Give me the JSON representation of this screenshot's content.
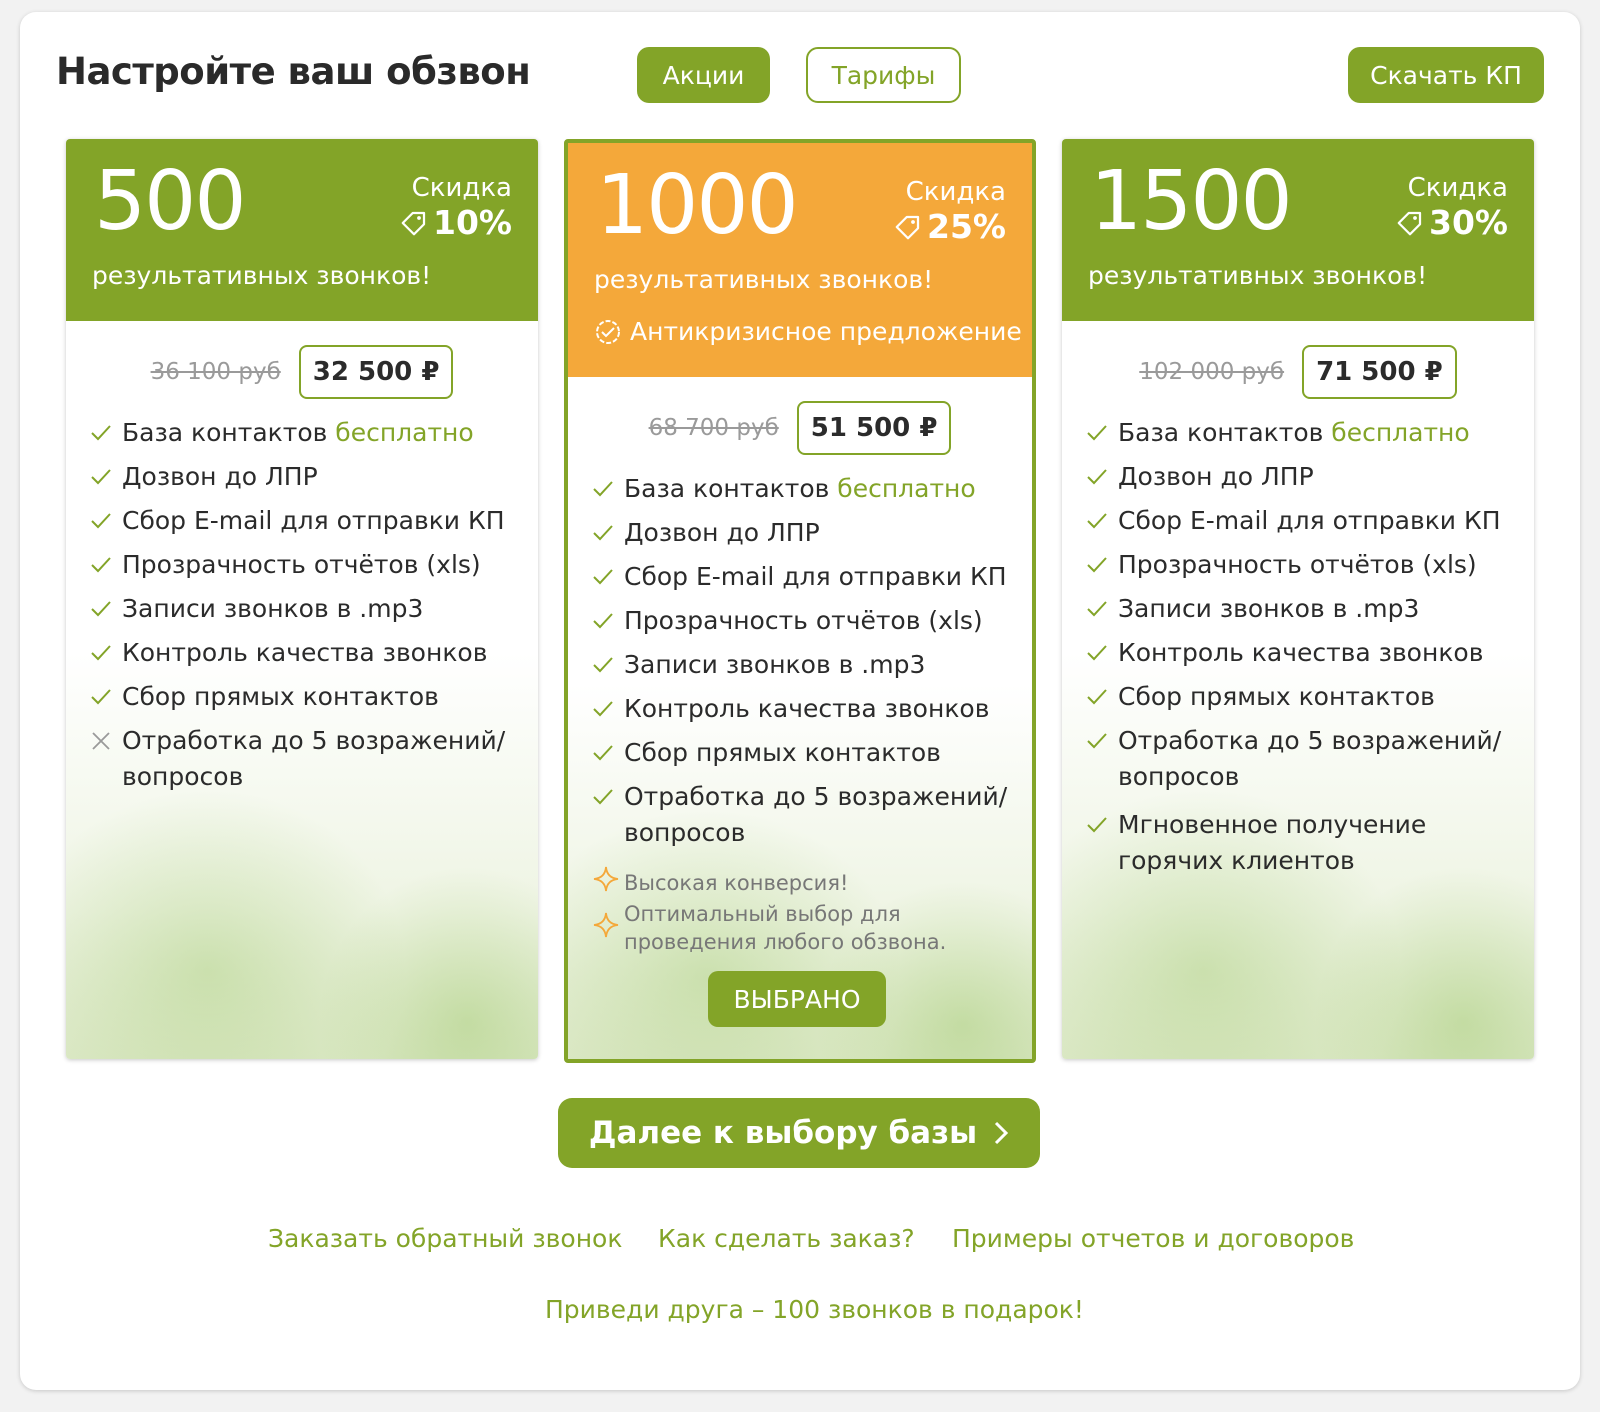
{
  "header": {
    "title": "Настройте ваш обзвон",
    "promo_label": "Акции",
    "tariffs_label": "Тарифы",
    "download_label": "Скачать КП"
  },
  "colors": {
    "accent": "#83a428",
    "highlight_card": "#f4a83a",
    "muted": "#9a9a9a"
  },
  "cards": [
    {
      "qty": "500",
      "discount_label": "Скидка",
      "discount_value": "10%",
      "subtitle": "результативных звонков!",
      "old_price": "36 100 руб",
      "new_price": "32 500 ₽",
      "features": {
        "f1": "База контактов ",
        "f1_hl": "бесплатно",
        "f2": "Дозвон до ЛПР",
        "f3": "Сбор E-mail для отправки КП",
        "f4": "Прозрачность отчётов (xls)",
        "f5": "Записи звонков в .mp3",
        "f6": "Контроль качества звонков",
        "f7": "Сбор прямых контактов",
        "f8": "Отработка до 5 возражений/ вопросов"
      }
    },
    {
      "qty": "1000",
      "discount_label": "Скидка",
      "discount_value": "25%",
      "subtitle": "результативных звонков!",
      "badge": "Антикризисное предложение",
      "old_price": "68 700 руб",
      "new_price": "51 500 ₽",
      "features": {
        "f1": "База контактов ",
        "f1_hl": "бесплатно",
        "f2": "Дозвон до ЛПР",
        "f3": "Сбор E-mail для отправки КП",
        "f4": "Прозрачность отчётов (xls)",
        "f5": "Записи звонков в .mp3",
        "f6": "Контроль качества звонков",
        "f7": "Сбор прямых контактов",
        "f8": "Отработка до 5 возражений/ вопросов"
      },
      "perk_1": "Высокая конверсия!",
      "perk_2": "Оптимальный выбор для проведения любого обзвона.",
      "chosen_label": "ВЫБРАНО"
    },
    {
      "qty": "1500",
      "discount_label": "Скидка",
      "discount_value": "30%",
      "subtitle": "результативных звонков!",
      "old_price": "102 000 руб",
      "new_price": "71 500 ₽",
      "features": {
        "f1": "База контактов ",
        "f1_hl": "бесплатно",
        "f2": "Дозвон до ЛПР",
        "f3": "Сбор E-mail для отправки КП",
        "f4": "Прозрачность отчётов (xls)",
        "f5": "Записи звонков в .mp3",
        "f6": "Контроль качества звонков",
        "f7": "Сбор прямых контактов",
        "f8": "Отработка до 5 возражений/ вопросов",
        "f9": "Мгновенное получение горячих клиентов"
      }
    }
  ],
  "footer": {
    "next_label": "Далее к выбору базы",
    "link_call": "Заказать обратный звонок",
    "link_how": "Как сделать заказ?",
    "link_examples": "Примеры отчетов и договоров",
    "link_friend": "Приведи друга – 100 звонков в подарок!"
  }
}
